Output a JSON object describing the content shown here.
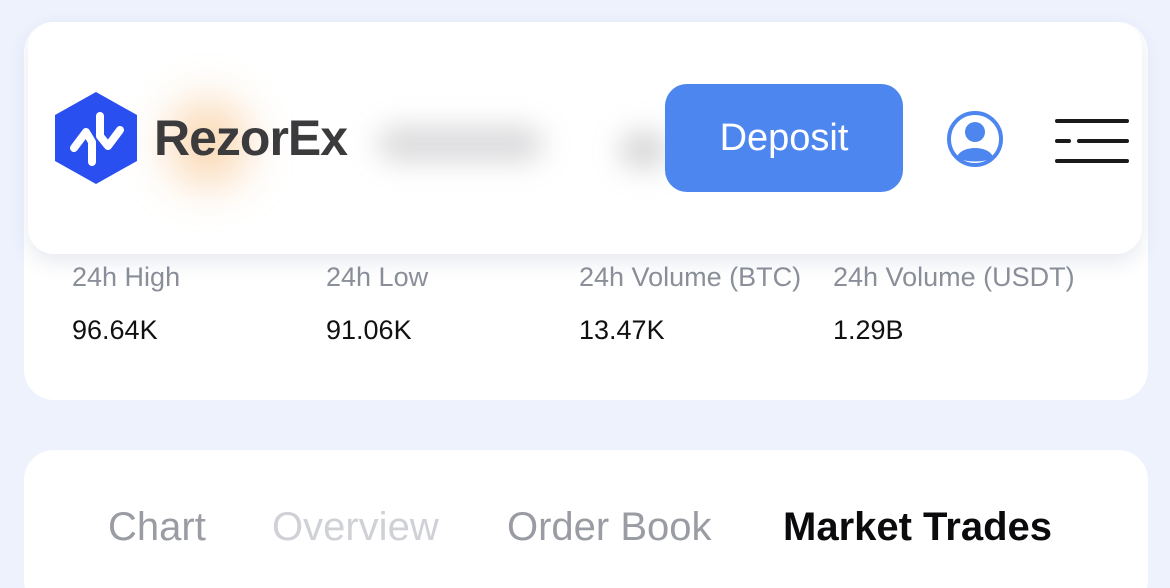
{
  "brand": {
    "name": "RezorEx",
    "accent": "#4e86f0",
    "logo_color": "#2a4ff0"
  },
  "header": {
    "deposit_label": "Deposit",
    "account_icon": "user-circle-icon",
    "menu_icon": "hamburger-menu-icon"
  },
  "stats": [
    {
      "label": "24h High",
      "value": "96.64K"
    },
    {
      "label": "24h Low",
      "value": "91.06K"
    },
    {
      "label": "24h Volume (BTC)",
      "value": "13.47K"
    },
    {
      "label": "24h Volume (USDT)",
      "value": "1.29B"
    }
  ],
  "tabs": [
    {
      "label": "Chart",
      "active": false
    },
    {
      "label": "Overview",
      "active": false
    },
    {
      "label": "Order Book",
      "active": false
    },
    {
      "label": "Market Trades",
      "active": true
    }
  ]
}
